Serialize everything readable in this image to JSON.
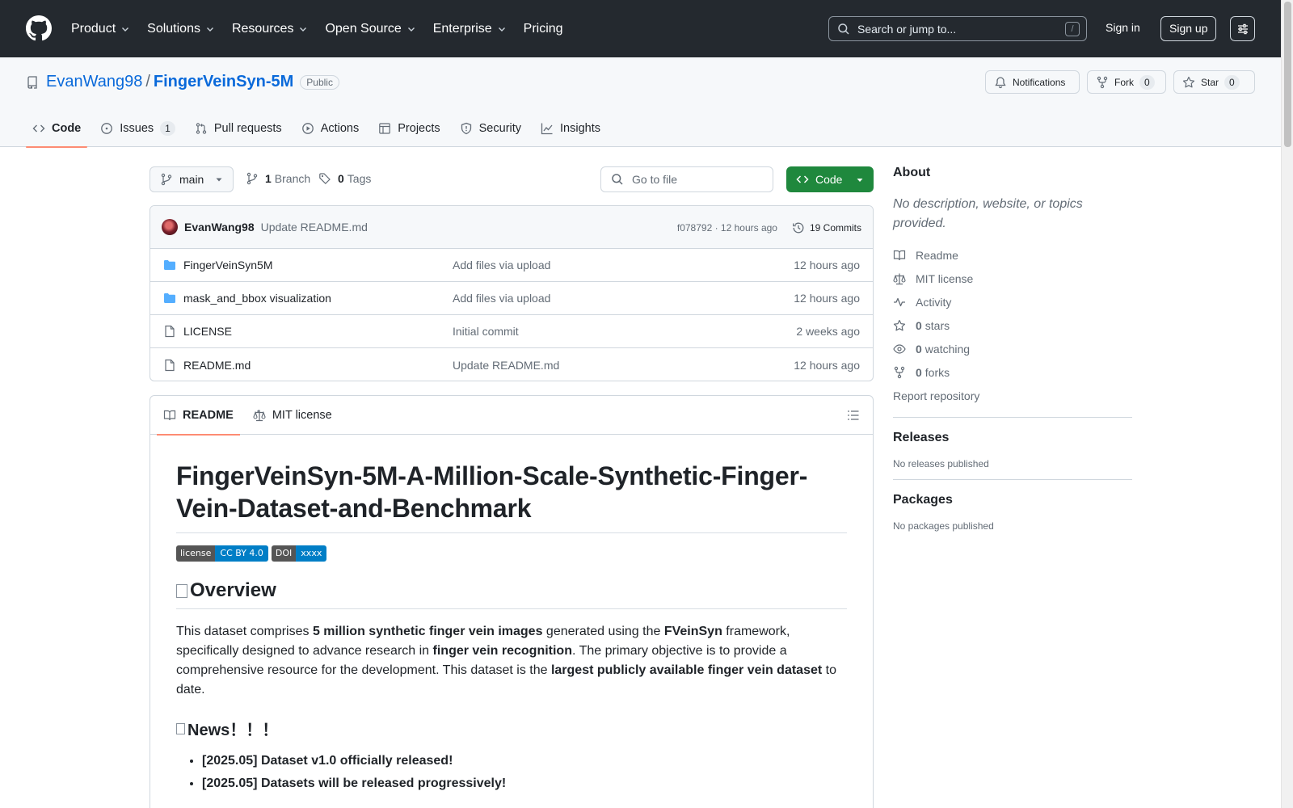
{
  "nav": {
    "items": [
      "Product",
      "Solutions",
      "Resources",
      "Open Source",
      "Enterprise",
      "Pricing"
    ],
    "search_placeholder": "Search or jump to...",
    "search_key": "/",
    "sign_in": "Sign in",
    "sign_up": "Sign up"
  },
  "repo": {
    "owner": "EvanWang98",
    "separator": "/",
    "name": "FingerVeinSyn-5M",
    "visibility": "Public",
    "notifications_label": "Notifications",
    "fork_label": "Fork",
    "fork_count": "0",
    "star_label": "Star",
    "star_count": "0",
    "tabs": [
      {
        "label": "Code",
        "icon": "code-icon",
        "active": true
      },
      {
        "label": "Issues",
        "icon": "issue-icon",
        "count": "1"
      },
      {
        "label": "Pull requests",
        "icon": "pull-request-icon"
      },
      {
        "label": "Actions",
        "icon": "play-icon"
      },
      {
        "label": "Projects",
        "icon": "table-icon"
      },
      {
        "label": "Security",
        "icon": "shield-icon"
      },
      {
        "label": "Insights",
        "icon": "graph-icon"
      }
    ]
  },
  "toolbar": {
    "branch": "main",
    "branch_count": "1",
    "branch_label": "Branch",
    "tag_count": "0",
    "tag_label": "Tags",
    "goto_placeholder": "Go to file",
    "code_label": "Code"
  },
  "commit": {
    "author": "EvanWang98",
    "message": "Update README.md",
    "hash_time": "f078792 · 12 hours ago",
    "commits_label": "19 Commits"
  },
  "files": [
    {
      "name": "FingerVeinSyn5M",
      "type": "folder",
      "message": "Add files via upload",
      "age": "12 hours ago"
    },
    {
      "name": "mask_and_bbox visualization",
      "type": "folder",
      "message": "Add files via upload",
      "age": "12 hours ago"
    },
    {
      "name": "LICENSE",
      "type": "file",
      "message": "Initial commit",
      "age": "2 weeks ago"
    },
    {
      "name": "README.md",
      "type": "file",
      "message": "Update README.md",
      "age": "12 hours ago"
    }
  ],
  "readme": {
    "tab_readme": "README",
    "tab_license": "MIT license",
    "title": "FingerVeinSyn-5M-A-Million-Scale-Synthetic-Finger-Vein-Dataset-and-Benchmark",
    "badges": [
      {
        "left": "license",
        "right": "CC BY 4.0"
      },
      {
        "left": "DOI",
        "right": "xxxx"
      }
    ],
    "overview_heading": "Overview",
    "overview": {
      "t1": "This dataset comprises ",
      "b1": "5 million synthetic finger vein images",
      "t2": " generated using the ",
      "b2": "FVeinSyn",
      "t3": " framework, specifically designed to advance research in ",
      "b3": "finger vein recognition",
      "t4": ". The primary objective is to provide a comprehensive resource for the development. This dataset is the ",
      "b4": "largest publicly available finger vein dataset",
      "t5": " to date."
    },
    "news_heading": "News！！！",
    "news": [
      "[2025.05] Dataset v1.0 officially released!",
      "[2025.05] Datasets will be released progressively!"
    ]
  },
  "sidebar": {
    "about_heading": "About",
    "description": "No description, website, or topics provided.",
    "links": [
      {
        "icon": "book-icon",
        "label": "Readme"
      },
      {
        "icon": "law-icon",
        "label": "MIT license"
      },
      {
        "icon": "pulse-icon",
        "label": "Activity"
      },
      {
        "icon": "star-icon",
        "count": "0",
        "label": "stars"
      },
      {
        "icon": "eye-icon",
        "count": "0",
        "label": "watching"
      },
      {
        "icon": "fork-icon",
        "count": "0",
        "label": "forks"
      }
    ],
    "report": "Report repository",
    "releases_heading": "Releases",
    "releases_text": "No releases published",
    "packages_heading": "Packages",
    "packages_text": "No packages published"
  },
  "colors": {
    "header_bg": "#24292f",
    "link": "#0969da",
    "code_button": "#1f883d",
    "active_tab_underline": "#fd8c73"
  }
}
